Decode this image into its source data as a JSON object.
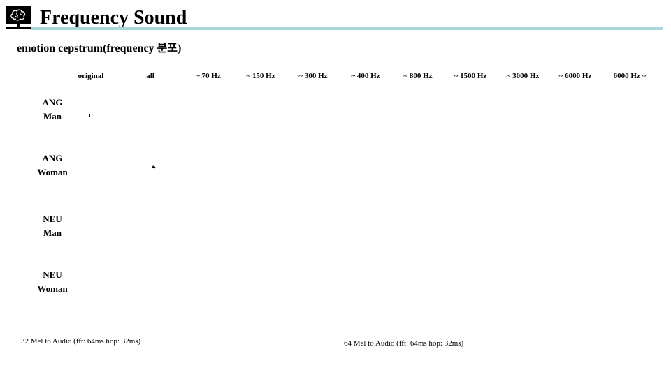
{
  "header": {
    "title": "Frequency Sound",
    "logo_icon": "brain-monitor-icon",
    "rule_color": "#a9d6d8"
  },
  "subtitle": "emotion cepstrum(frequency 분포)",
  "columns": [
    "original",
    "all",
    "~ 70 Hz",
    "~ 150 Hz",
    "~ 300 Hz",
    "~ 400 Hz",
    "~ 800 Hz",
    "~ 1500 Hz",
    "~ 3000 Hz",
    "~ 6000 Hz",
    "6000 Hz ~"
  ],
  "rows": [
    {
      "emotion": "ANG",
      "gender": "Man"
    },
    {
      "emotion": "ANG",
      "gender": "Woman"
    },
    {
      "emotion": "NEU",
      "gender": "Man"
    },
    {
      "emotion": "NEU",
      "gender": "Woman"
    }
  ],
  "footnotes": {
    "left": "32 Mel to Audio (fft: 64ms hop: 32ms)",
    "right": "64 Mel to Audio (fft: 64ms hop: 32ms)"
  }
}
